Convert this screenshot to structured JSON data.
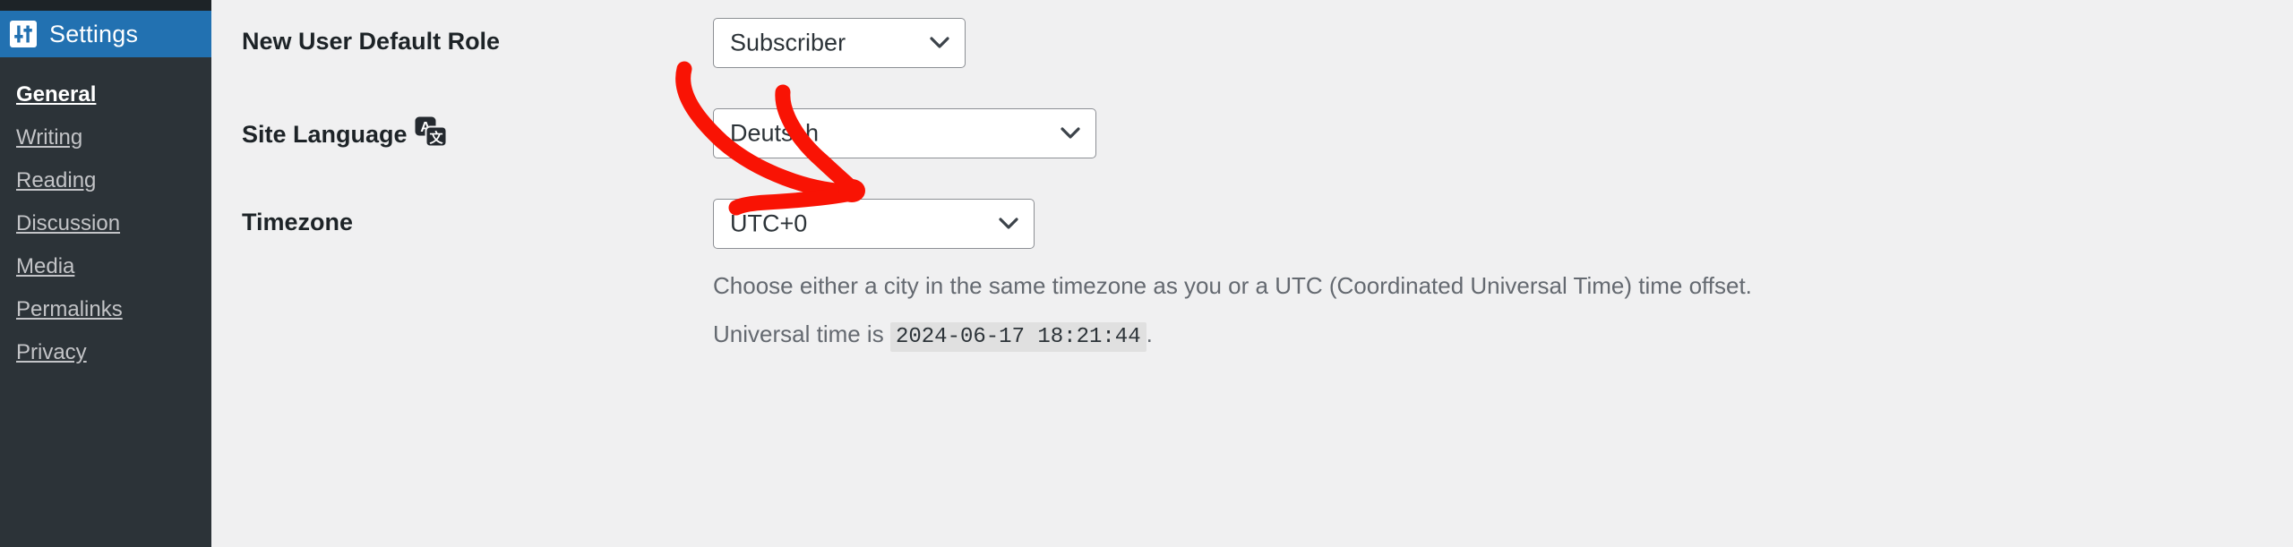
{
  "sidebar": {
    "menu_header": {
      "label": "Settings",
      "icon": "settings-sliders-icon",
      "background": "#2271b1"
    },
    "items": [
      {
        "label": "General",
        "current": true
      },
      {
        "label": "Writing",
        "current": false
      },
      {
        "label": "Reading",
        "current": false
      },
      {
        "label": "Discussion",
        "current": false
      },
      {
        "label": "Media",
        "current": false
      },
      {
        "label": "Permalinks",
        "current": false
      },
      {
        "label": "Privacy",
        "current": false
      }
    ]
  },
  "main": {
    "rows": [
      {
        "label": "New User Default Role",
        "icon": null,
        "select_value": "Subscriber"
      },
      {
        "label": "Site Language",
        "icon": "translation-icon",
        "select_value": "Deutsch"
      },
      {
        "label": "Timezone",
        "icon": null,
        "select_value": "UTC+0"
      }
    ],
    "timezone_description": "Choose either a city in the same timezone as you or a UTC (Coordinated Universal Time) time offset.",
    "universal_time_prefix": "Universal time is",
    "universal_time_value": "2024-06-17 18:21:44",
    "universal_time_suffix": "."
  },
  "annotation": {
    "type": "hand-drawn-arrow",
    "color": "#f91304",
    "points_to": "Deutsch"
  },
  "colors": {
    "page_background": "#f0f0f1",
    "sidebar_background": "#2c3338",
    "sidebar_topstrip": "#1d2327",
    "accent_blue": "#2271b1",
    "label_text": "#1d2327",
    "muted_text": "#646970",
    "submenu_text": "#c3c4c7",
    "select_border": "#8c8f94",
    "annotation_red": "#f91304",
    "code_background": "#e0e0e0"
  }
}
